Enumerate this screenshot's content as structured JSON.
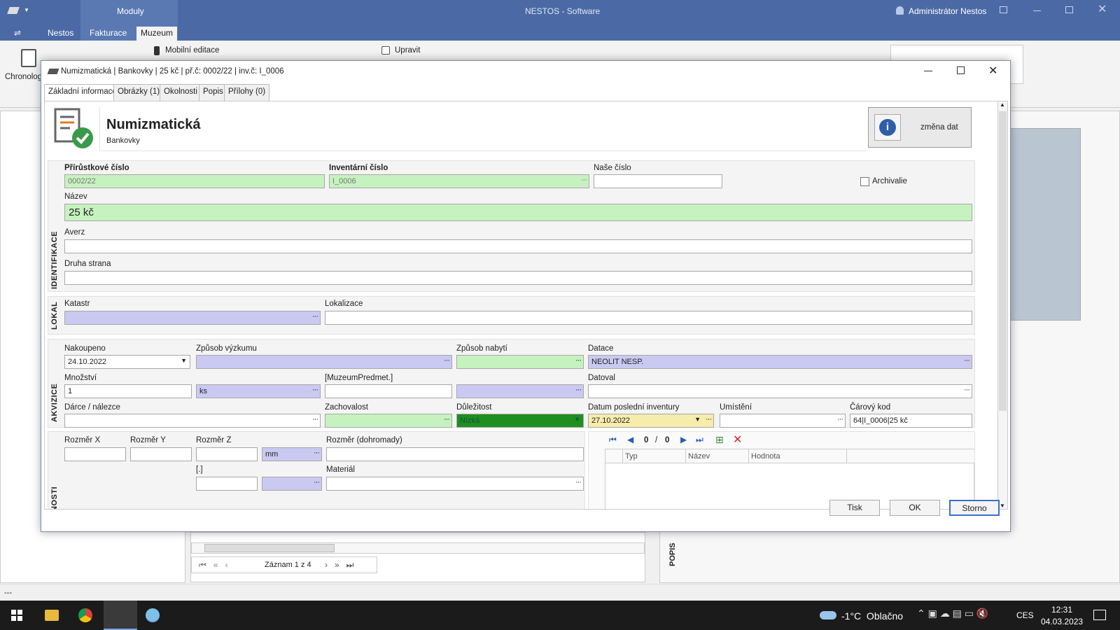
{
  "app": {
    "moduly_label": "Moduly",
    "title": "NESTOS - Software",
    "user": "Administrátor Nestos",
    "ribbon_tabs": [
      "Nestos",
      "Fakturace",
      "Muzeum"
    ],
    "ribbon_items": {
      "mobilni_editace": "Mobilní editace",
      "upravit": "Upravit",
      "chronolog": "Chronolog"
    },
    "record_nav": "Záznam 1 z 4",
    "side_popis_label": "POPIS",
    "status_text": "---"
  },
  "dialog": {
    "title": "Numizmatická | Bankovky | 25 kč | př.č: 0002/22 | inv.č: I_0006",
    "tabs": [
      "Základní informace",
      "Obrázky (1)",
      "Okolnosti",
      "Popis",
      "Přílohy (0)"
    ],
    "header": {
      "title": "Numizmatická",
      "subtitle": "Bankovky",
      "change_button": "změna dat"
    },
    "sections": {
      "identifikace": "IDENTIFIKACE",
      "lokal": "LOKAL",
      "akvizice": "AKVIZICE",
      "vlastnosti": "NOSTI"
    },
    "identifikace": {
      "prirustkove_label": "Přírůstkové číslo",
      "prirustkove_value": "0002/22",
      "inventarni_label": "Inventární číslo",
      "inventarni_value": "I_0006",
      "nase_label": "Naše číslo",
      "nase_value": "",
      "archivalie_label": "Archivalie",
      "archivalie_checked": false,
      "nazev_label": "Název",
      "nazev_value": "25 kč",
      "averz_label": "Averz",
      "averz_value": "",
      "druha_label": "Druha strana",
      "druha_value": ""
    },
    "lokal": {
      "katastr_label": "Katastr",
      "katastr_value": "",
      "lokalizace_label": "Lokalizace",
      "lokalizace_value": ""
    },
    "akvizice": {
      "nakoupeno_label": "Nakoupeno",
      "nakoupeno_value": "24.10.2022",
      "zpusob_vyzkumu_label": "Způsob výzkumu",
      "zpusob_vyzkumu_value": "",
      "zpusob_nabyti_label": "Způsob nabytí",
      "zpusob_nabyti_value": "",
      "datace_label": "Datace",
      "datace_value": "NEOLIT NESP.",
      "mnozstvi_label": "Množství",
      "mnozstvi_value": "1",
      "jednotka_value": "ks",
      "muzeum_label": "[MuzeumPredmet.]",
      "muzeum_value": "",
      "datoval_label": "Datoval",
      "datoval_value": "",
      "darce_label": "Dárce / nálezce",
      "darce_value": "",
      "zachovalost_label": "Zachovalost",
      "zachovalost_value": "",
      "dulezitost_label": "Důležitost",
      "dulezitost_value": "Nízká",
      "datum_inv_label": "Datum poslední inventury",
      "datum_inv_value": "27.10.2022",
      "umisteni_label": "Umístění",
      "umisteni_value": "",
      "carovy_label": "Čárový kod",
      "carovy_value": "64|I_0006|25 kč"
    },
    "vlastnosti": {
      "rozmer_x_label": "Rozměr X",
      "rozmer_y_label": "Rozměr Y",
      "rozmer_z_label": "Rozměr Z",
      "jednotka_value": "mm",
      "rozmer_dohromady_label": "Rozměr (dohromady)",
      "extra_label": "[.]",
      "material_label": "Materiál",
      "nav_current": "0",
      "nav_sep": "/",
      "nav_total": "0",
      "table_headers": [
        "Typ",
        "Název",
        "Hodnota"
      ]
    },
    "buttons": {
      "print": "Tisk",
      "ok": "OK",
      "cancel": "Storno"
    }
  },
  "taskbar": {
    "weather": "-1°C  Oblačno",
    "lang": "CES",
    "time": "12:31",
    "date": "04.03.2023"
  }
}
